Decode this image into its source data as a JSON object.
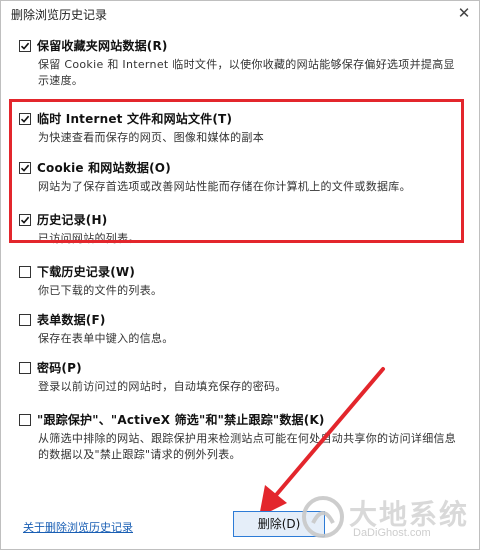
{
  "window": {
    "title": "删除浏览历史记录",
    "close_glyph": "✕"
  },
  "options": [
    {
      "label": "保留收藏夹网站数据(R)",
      "description": "保留 Cookie 和 Internet 临时文件，以使你收藏的网站能够保存偏好选项并提高显示速度。",
      "checked": true
    },
    {
      "label": "临时 Internet 文件和网站文件(T)",
      "description": "为快速查看而保存的网页、图像和媒体的副本",
      "checked": true
    },
    {
      "label": "Cookie 和网站数据(O)",
      "description": "网站为了保存首选项或改善网站性能而存储在你计算机上的文件或数据库。",
      "checked": true
    },
    {
      "label": "历史记录(H)",
      "description": "已访问网站的列表。",
      "checked": true
    },
    {
      "label": "下载历史记录(W)",
      "description": "你已下载的文件的列表。",
      "checked": false
    },
    {
      "label": "表单数据(F)",
      "description": "保存在表单中键入的信息。",
      "checked": false
    },
    {
      "label": "密码(P)",
      "description": "登录以前访问过的网站时，自动填充保存的密码。",
      "checked": false
    },
    {
      "label": "\"跟踪保护\"、\"ActiveX 筛选\"和\"禁止跟踪\"数据(K)",
      "description": "从筛选中排除的网站、跟踪保护用来检测站点可能在何处自动共享你的访问详细信息的数据以及\"禁止跟踪\"请求的例外列表。",
      "checked": false
    }
  ],
  "footer": {
    "about_link": "关于删除浏览历史记录",
    "delete_button": "删除(D)"
  },
  "annotation": {
    "highlight_color": "#e3262c"
  },
  "watermark": {
    "title": "大地系统",
    "url": "DaDiGhost.com"
  }
}
